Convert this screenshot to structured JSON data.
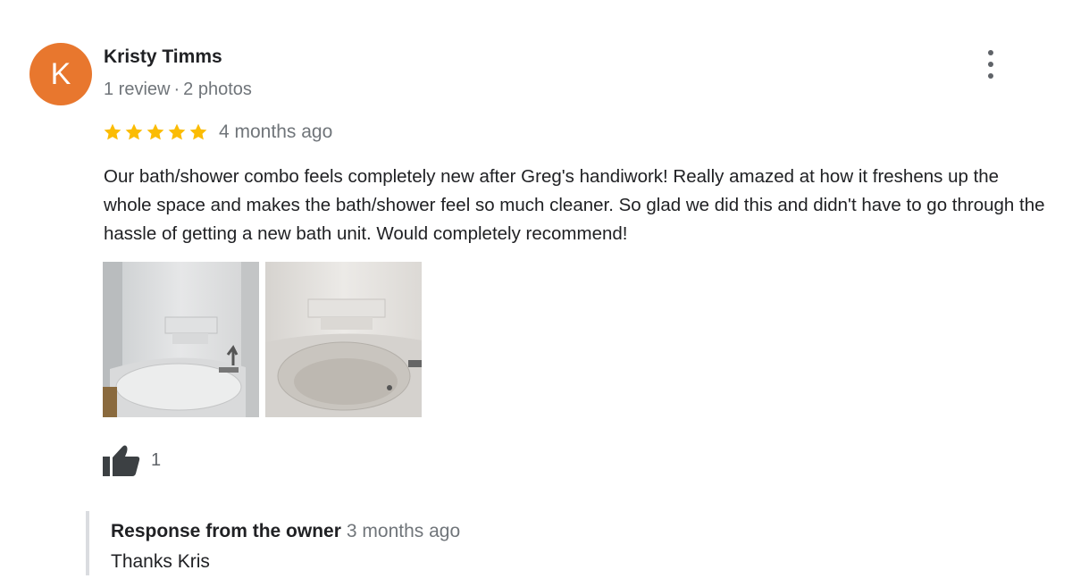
{
  "reviewer": {
    "initial": "K",
    "avatar_color": "#e8772e",
    "name": "Kristy Timms",
    "review_count": "1 review",
    "separator": "·",
    "photo_count": "2 photos"
  },
  "more_menu_icon": "vertical-dots-icon",
  "rating": {
    "stars": 5,
    "star_color": "#fbbc04",
    "time": "4 months ago"
  },
  "review_text": "Our bath/shower combo feels completely new after Greg's handiwork! Really amazed at how it freshens up the whole space and makes the bath/shower feel so much cleaner. So glad we did this and didn't have to go through the hassle of getting a new bath unit. Would completely recommend!",
  "photos": [
    {
      "subject": "bathtub-shower-photo-1"
    },
    {
      "subject": "bathtub-shower-photo-2"
    }
  ],
  "likes": {
    "icon": "thumbs-up-icon",
    "count": "1"
  },
  "owner_response": {
    "title": "Response from the owner",
    "time": "3 months ago",
    "text": "Thanks Kris"
  }
}
